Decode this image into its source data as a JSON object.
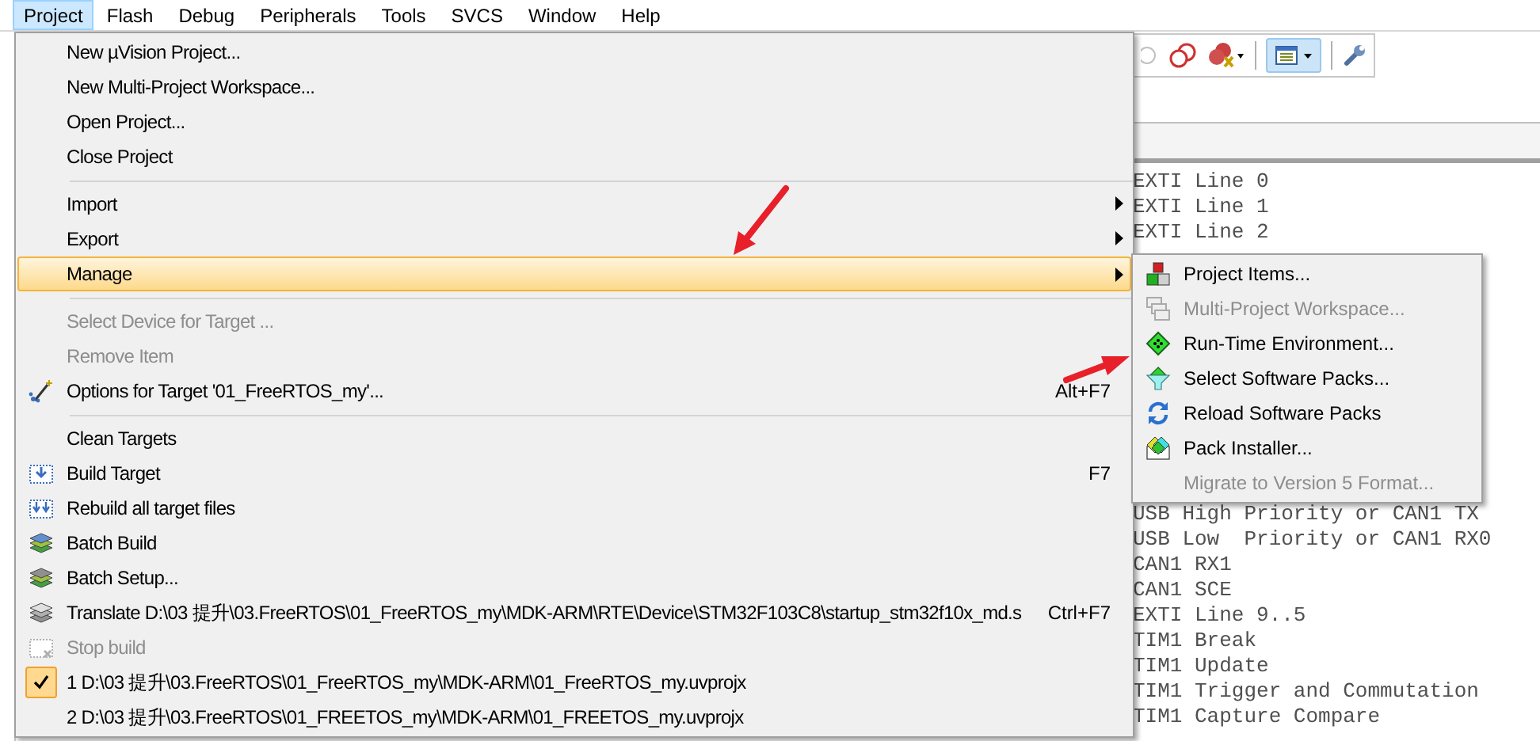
{
  "menubar": [
    {
      "label": "Project",
      "selected": true
    },
    {
      "label": "Flash",
      "selected": false
    },
    {
      "label": "Debug",
      "selected": false
    },
    {
      "label": "Peripherals",
      "selected": false
    },
    {
      "label": "Tools",
      "selected": false
    },
    {
      "label": "SVCS",
      "selected": false
    },
    {
      "label": "Window",
      "selected": false
    },
    {
      "label": "Help",
      "selected": false
    }
  ],
  "project_menu": {
    "items": [
      {
        "kind": "item",
        "label": "New µVision Project...",
        "disabled": false,
        "submenu": false,
        "selected": false,
        "checked": false
      },
      {
        "kind": "item",
        "label": "New Multi-Project Workspace...",
        "disabled": false,
        "submenu": false,
        "selected": false,
        "checked": false
      },
      {
        "kind": "item",
        "label": "Open Project...",
        "disabled": false,
        "submenu": false,
        "selected": false,
        "checked": false
      },
      {
        "kind": "item",
        "label": "Close Project",
        "disabled": false,
        "submenu": false,
        "selected": false,
        "checked": false
      },
      {
        "kind": "separator"
      },
      {
        "kind": "item",
        "label": "Import",
        "disabled": false,
        "submenu": true,
        "selected": false,
        "checked": false
      },
      {
        "kind": "item",
        "label": "Export",
        "disabled": false,
        "submenu": true,
        "selected": false,
        "checked": false
      },
      {
        "kind": "item",
        "label": "Manage",
        "disabled": false,
        "submenu": true,
        "selected": true,
        "checked": false
      },
      {
        "kind": "separator"
      },
      {
        "kind": "item",
        "label": "Select Device for Target ...",
        "disabled": true,
        "submenu": false,
        "selected": false,
        "checked": false
      },
      {
        "kind": "item",
        "label": "Remove Item",
        "disabled": true,
        "submenu": false,
        "selected": false,
        "checked": false
      },
      {
        "kind": "item",
        "label": "Options for Target '01_FreeRTOS_my'...",
        "shortcut": "Alt+F7",
        "disabled": false,
        "submenu": false,
        "selected": false,
        "checked": false
      },
      {
        "kind": "separator"
      },
      {
        "kind": "item",
        "label": "Clean Targets",
        "disabled": false,
        "submenu": false,
        "selected": false,
        "checked": false
      },
      {
        "kind": "item",
        "label": "Build Target",
        "shortcut": "F7",
        "disabled": false,
        "submenu": false,
        "selected": false,
        "checked": false
      },
      {
        "kind": "item",
        "label": "Rebuild all target files",
        "disabled": false,
        "submenu": false,
        "selected": false,
        "checked": false
      },
      {
        "kind": "item",
        "label": "Batch Build",
        "disabled": false,
        "submenu": false,
        "selected": false,
        "checked": false
      },
      {
        "kind": "item",
        "label": "Batch Setup...",
        "disabled": false,
        "submenu": false,
        "selected": false,
        "checked": false
      },
      {
        "kind": "item",
        "label": "Translate D:\\03 提升\\03.FreeRTOS\\01_FreeRTOS_my\\MDK-ARM\\RTE\\Device\\STM32F103C8\\startup_stm32f10x_md.s",
        "shortcut": "Ctrl+F7",
        "disabled": false,
        "submenu": false,
        "selected": false,
        "checked": false
      },
      {
        "kind": "item",
        "label": "Stop build",
        "disabled": true,
        "submenu": false,
        "selected": false,
        "checked": false
      },
      {
        "kind": "item",
        "label": "1 D:\\03 提升\\03.FreeRTOS\\01_FreeRTOS_my\\MDK-ARM\\01_FreeRTOS_my.uvprojx",
        "disabled": false,
        "submenu": false,
        "selected": false,
        "checked": true
      },
      {
        "kind": "item",
        "label": "2 D:\\03 提升\\03.FreeRTOS\\01_FREETOS_my\\MDK-ARM\\01_FREETOS_my.uvprojx",
        "disabled": false,
        "submenu": false,
        "selected": false,
        "checked": false
      }
    ]
  },
  "manage_submenu": {
    "items": [
      {
        "label": "Project Items...",
        "disabled": false
      },
      {
        "label": "Multi-Project Workspace...",
        "disabled": true
      },
      {
        "label": "Run-Time Environment...",
        "disabled": false
      },
      {
        "label": "Select Software Packs...",
        "disabled": false
      },
      {
        "label": "Reload Software Packs",
        "disabled": false
      },
      {
        "label": "Pack Installer...",
        "disabled": false
      },
      {
        "label": "Migrate to Version 5 Format...",
        "disabled": true
      }
    ]
  },
  "editor": {
    "lines_top": [
      "EXTI Line 0",
      "EXTI Line 1",
      "EXTI Line 2"
    ],
    "lines_bottom": [
      "USB High Priority or CAN1 TX",
      "USB Low  Priority or CAN1 RX0",
      "CAN1 RX1",
      "CAN1 SCE",
      "EXTI Line 9..5",
      "TIM1 Break",
      "TIM1 Update",
      "TIM1 Trigger and Commutation",
      "TIM1 Capture Compare"
    ]
  }
}
